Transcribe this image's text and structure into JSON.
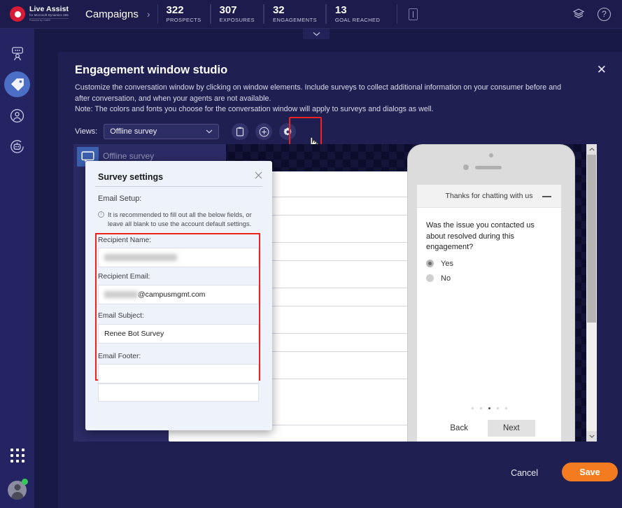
{
  "topbar": {
    "logo": {
      "name": "Live Assist",
      "sub": "for Microsoft Dynamics 365",
      "sub2": "Powered by CafeX"
    },
    "breadcrumb": "Campaigns",
    "breadcrumb_sep": "›",
    "metrics": [
      {
        "value": "322",
        "label": "PROSPECTS"
      },
      {
        "value": "307",
        "label": "EXPOSURES"
      },
      {
        "value": "32",
        "label": "ENGAGEMENTS"
      },
      {
        "value": "13",
        "label": "GOAL REACHED"
      }
    ],
    "note_icon": "❙",
    "layers_icon": "layers-icon",
    "help_icon": "?",
    "collapse_chevron": "⌄"
  },
  "rail": {
    "items": [
      {
        "name": "agent-chat-icon",
        "label": "Agents",
        "active": false
      },
      {
        "name": "tag-icon",
        "label": "Campaigns",
        "active": true
      },
      {
        "name": "person-icon",
        "label": "Visitors",
        "active": false
      },
      {
        "name": "bot-icon",
        "label": "Bots",
        "active": false
      }
    ],
    "apps_icon": "grid-icon",
    "avatar_status": "online"
  },
  "modal": {
    "title": "Engagement window studio",
    "close": "✕",
    "description": "Customize the conversation window by clicking on window elements. Include surveys to collect additional information on your consumer before and after conversation, and when your agents are not available.",
    "note": "Note: The colors and fonts you choose for the conversation window will apply to surveys and dialogs as well.",
    "views_label": "Views:",
    "views_value": "Offline survey",
    "views_chevron": "⌄",
    "tools": [
      {
        "name": "duplicate-icon",
        "glyph": "▯"
      },
      {
        "name": "add-icon",
        "glyph": "⊕"
      },
      {
        "name": "settings-gear-icon",
        "glyph": "⚙"
      }
    ]
  },
  "stage": {
    "chat_bubble_icon": "chat-bubble-icon",
    "heading": "Offline survey"
  },
  "phone_preview": {
    "header_title": "Thanks for chatting with us",
    "minimize_icon": "minimize-icon",
    "question": "Was the issue you contacted us about resolved during this engagement?",
    "options": [
      {
        "label": "Yes",
        "selected": true
      },
      {
        "label": "No",
        "selected": false
      }
    ],
    "page_dots": {
      "total": 5,
      "active_index": 2
    },
    "back_label": "Back",
    "next_label": "Next"
  },
  "survey_settings": {
    "title": "Survey settings",
    "close": "✕",
    "section_label": "Email Setup:",
    "hint": "It is recommended to fill out all the below fields, or leave all blank to use the account default settings.",
    "hint_icon": "info-icon",
    "fields": [
      {
        "label": "Recipient Name:",
        "value": "",
        "redacted": "Stephanie Crowley",
        "redacted_suffix": ""
      },
      {
        "label": "Recipient Email:",
        "value": "",
        "redacted": "sxcrowley",
        "redacted_suffix": "@campusmgmt.com"
      },
      {
        "label": "Email Subject:",
        "value": "Renee Bot Survey",
        "redacted": "",
        "redacted_suffix": ""
      },
      {
        "label": "Email Footer:",
        "value": "",
        "redacted": "",
        "redacted_suffix": ""
      }
    ]
  },
  "footer": {
    "cancel_label": "Cancel",
    "save_label": "Save"
  },
  "colors": {
    "brand_navy": "#1c1b4b",
    "rail_navy": "#242463",
    "accent_orange": "#f47b20",
    "highlight_red": "#ef2222",
    "active_blue": "#4a6fc4",
    "logo_red": "#d81b36"
  }
}
